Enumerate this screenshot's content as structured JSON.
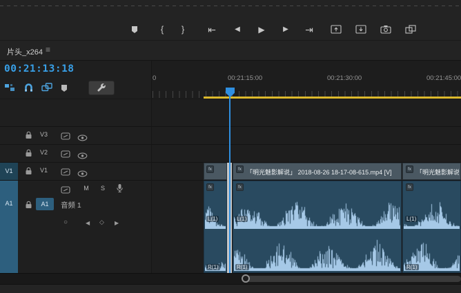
{
  "panel": {
    "tab_title": "片头_x264",
    "menu_icon": "≡"
  },
  "transport": {
    "mark_in": "{",
    "mark_out": "}",
    "goto_in": "⇤",
    "step_back": "◀",
    "play": "▶",
    "step_forward": "▶",
    "goto_out": "⇥"
  },
  "timecode": "00:21:13:18",
  "ruler": {
    "labels": [
      "0",
      "00:21:15:00",
      "00:21:30:00",
      "00:21:45:00"
    ]
  },
  "tracks": {
    "source_video": "V1",
    "source_audio": "A1",
    "video": [
      {
        "label": "V3"
      },
      {
        "label": "V2"
      },
      {
        "label": "V1"
      }
    ],
    "audio": {
      "select": "A1",
      "name": "音频 1",
      "mute": "M",
      "solo": "S"
    },
    "keyframes": {
      "mode": "○",
      "prev": "◀",
      "add": "◇",
      "next": "▶"
    }
  },
  "clips": {
    "fx_badge": "fx",
    "video_title": "「明光魅影解说」 2018-08-26 18-17-08-615.mp4 [V]",
    "audio_left": "L(1)",
    "audio_right": "R(1)"
  },
  "colors": {
    "accent_blue": "#38a0e8",
    "playhead": "#2f8fe0",
    "work_bar": "#dcb92c",
    "video_clip": "#4a5862",
    "audio_clip": "#294a60",
    "waveform": "#a6c9e7"
  }
}
